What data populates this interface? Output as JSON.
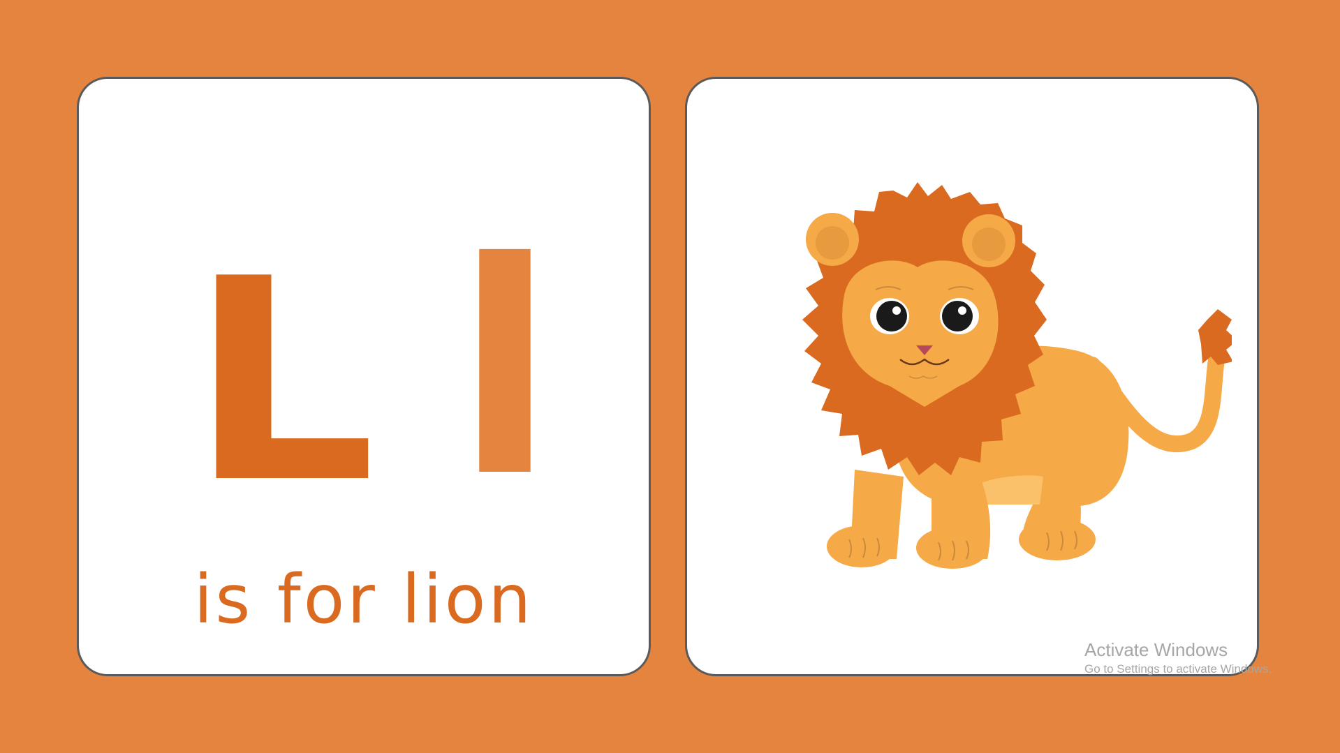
{
  "flashcard": {
    "uppercase_letter": "L",
    "lowercase_letter": "l",
    "phrase": "is for lion",
    "illustration": "lion-illustration",
    "colors": {
      "background": "#e5843f",
      "card": "#ffffff",
      "card_border": "#5a5a5a",
      "uppercase": "#d96a20",
      "lowercase": "#e5843f",
      "phrase": "#d96a20",
      "mane": "#d96a20",
      "fur": "#f6a947"
    }
  },
  "watermark": {
    "title": "Activate Windows",
    "subtitle": "Go to Settings to activate Windows."
  }
}
